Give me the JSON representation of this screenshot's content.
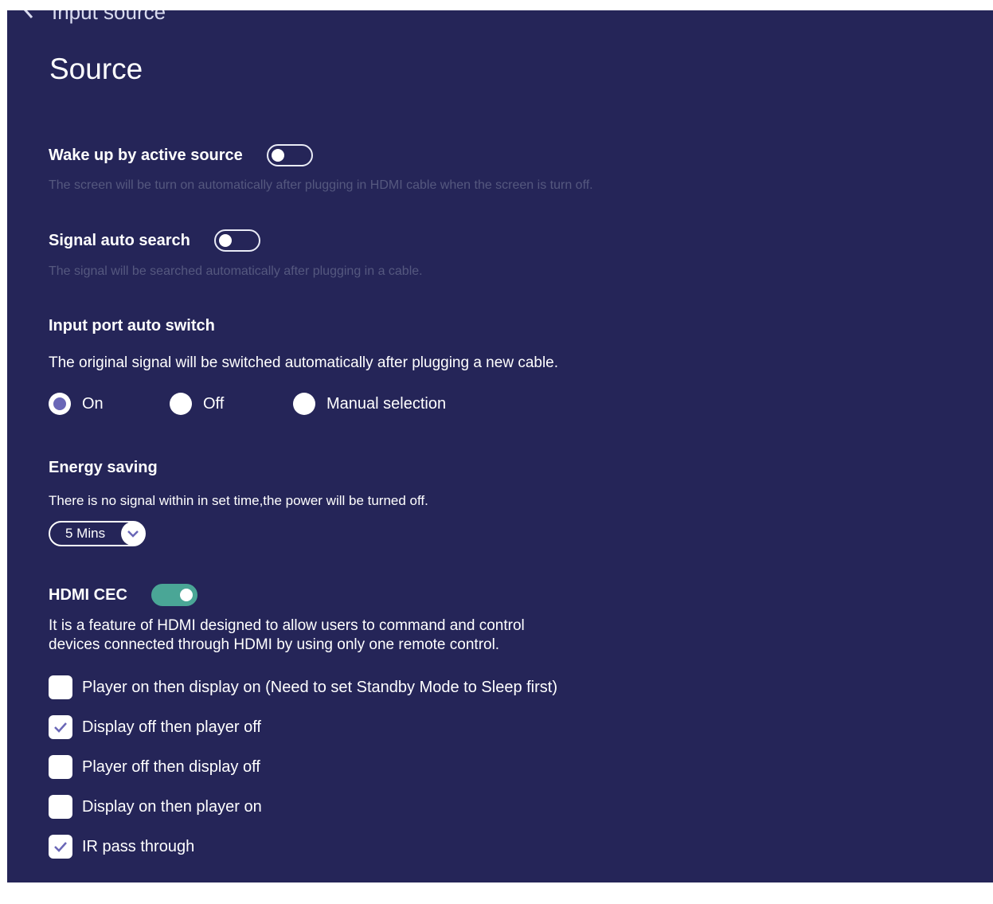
{
  "header": {
    "back_icon": "chevron-left-icon",
    "title_partial": "Input source",
    "page_title": "Source"
  },
  "wake_up": {
    "label": "Wake up by active source",
    "enabled": false,
    "description": "The screen will be turn on automatically after plugging in HDMI cable when the screen is turn off."
  },
  "signal_search": {
    "label": "Signal auto search",
    "enabled": false,
    "description": "The signal will be searched automatically after plugging in a cable."
  },
  "auto_switch": {
    "label": "Input port auto switch",
    "description": "The original signal will be switched automatically after plugging a new cable.",
    "options": [
      {
        "label": "On",
        "selected": true
      },
      {
        "label": "Off",
        "selected": false
      },
      {
        "label": "Manual selection",
        "selected": false
      }
    ]
  },
  "energy_saving": {
    "label": "Energy saving",
    "description": "There is no signal within in set time,the power will be turned off.",
    "selected_value": "5 Mins"
  },
  "hdmi_cec": {
    "label": "HDMI CEC",
    "enabled": true,
    "description_line1": "It is a feature of HDMI designed to allow users to command and control",
    "description_line2": "devices connected through HDMI by using only one remote control.",
    "options": [
      {
        "label": "Player on then display on (Need to set Standby Mode to Sleep first)",
        "checked": false
      },
      {
        "label": "Display off then player off",
        "checked": true
      },
      {
        "label": "Player off then display off",
        "checked": false
      },
      {
        "label": "Display on then player on",
        "checked": false
      },
      {
        "label": "IR pass through",
        "checked": true
      }
    ]
  },
  "colors": {
    "background": "#252558",
    "toggle_on": "#4aa696",
    "radio_selected": "#6a67b7",
    "dim_text": "#55587f"
  }
}
